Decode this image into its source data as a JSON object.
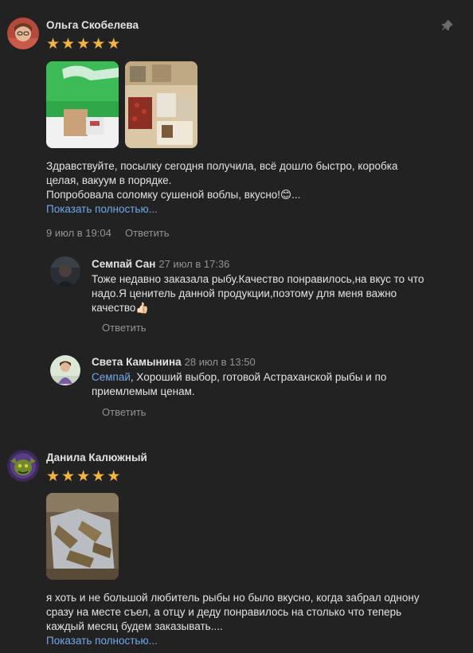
{
  "review1": {
    "author": "Ольга Скобелева",
    "rating": 5,
    "text_lines": [
      "Здравствуйте, посылку сегодня получила, всё дошло быстро, коробка",
      "целая, вакуум в порядке.",
      "Попробовала соломку сушеной воблы, вкусно!😊..."
    ],
    "show_more": "Показать полностью...",
    "date": "9 июл в 19:04",
    "reply_label": "Ответить",
    "pin_icon": "pin-icon",
    "photos": [
      "photo-green-box",
      "photo-dried-fish-table"
    ]
  },
  "reply1": {
    "author": "Семпай Сан",
    "date": "27 июл в 17:36",
    "text_lines": [
      "Тоже недавно заказала рыбу.Качество понравилось,на вкус то что",
      "надо.Я ценитель данной продукции,поэтому для меня важно",
      "качество👍🏻"
    ],
    "reply_label": "Ответить"
  },
  "reply2": {
    "author": "Света Камынина",
    "date": "28 июл в 13:50",
    "mention": "Семпай",
    "text_lines": [
      ", Хороший выбор, готовой Астраханской рыбы и по",
      "приемлемым ценам."
    ],
    "reply_label": "Ответить"
  },
  "review2": {
    "author": "Данила Калюжный",
    "rating": 5,
    "text_lines": [
      "я хоть и не большой любитель рыбы но было вкусно, когда забрал однону",
      "сразу на месте съел, а отцу и деду понравилось на столько что теперь",
      "каждый месяц будем заказывать...."
    ],
    "show_more": "Показать полностью...",
    "photos": [
      "photo-dried-fish-foil"
    ]
  },
  "colors": {
    "background": "#222222",
    "text": "#e1e3e6",
    "secondary": "#939393",
    "link": "#71aaeb",
    "star": "#f4b540"
  }
}
